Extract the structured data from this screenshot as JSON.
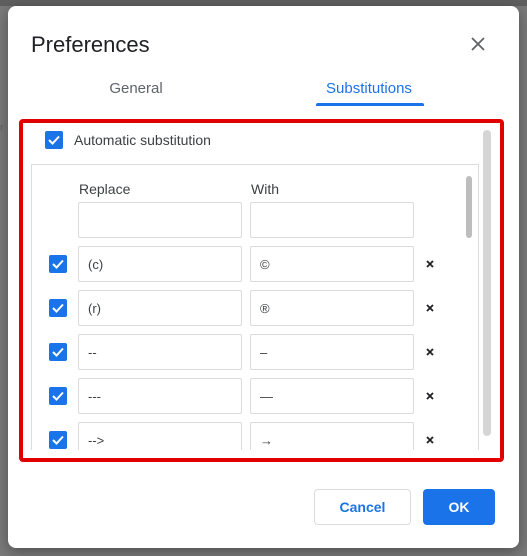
{
  "dialog": {
    "title": "Preferences",
    "close_icon": "close-icon"
  },
  "tabs": [
    {
      "label": "General",
      "active": false
    },
    {
      "label": "Substitutions",
      "active": true
    }
  ],
  "auto_substitution": {
    "label": "Automatic substitution",
    "checked": true
  },
  "table": {
    "headers": {
      "replace": "Replace",
      "with": "With"
    },
    "new_row": {
      "replace": "",
      "with": ""
    },
    "rows": [
      {
        "checked": true,
        "replace": "(c)",
        "with": "©"
      },
      {
        "checked": true,
        "replace": "(r)",
        "with": "®"
      },
      {
        "checked": true,
        "replace": "--",
        "with": "–"
      },
      {
        "checked": true,
        "replace": "---",
        "with": "—"
      },
      {
        "checked": true,
        "replace": "-->",
        "with": "→"
      }
    ],
    "delete_icon": "close-icon"
  },
  "buttons": {
    "cancel": "Cancel",
    "ok": "OK"
  },
  "colors": {
    "accent": "#1a73e8",
    "highlight_border": "#e00000"
  }
}
